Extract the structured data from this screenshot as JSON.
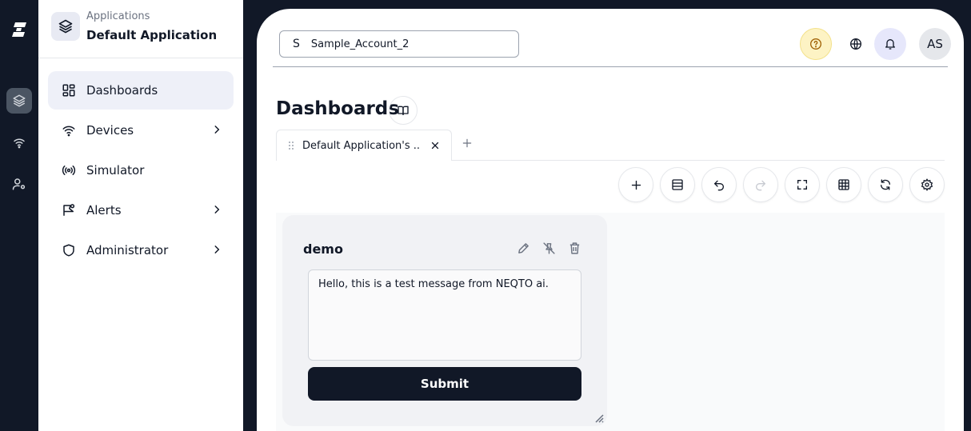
{
  "sidebar": {
    "app_label": "Applications",
    "app_name": "Default Application",
    "items": [
      {
        "label": "Dashboards",
        "icon": "dashboard-icon"
      },
      {
        "label": "Devices",
        "icon": "wifi-icon"
      },
      {
        "label": "Simulator",
        "icon": "broadcast-icon"
      },
      {
        "label": "Alerts",
        "icon": "alert-flag-icon"
      },
      {
        "label": "Administrator",
        "icon": "shield-icon"
      }
    ]
  },
  "header": {
    "account_initial": "S",
    "account_name": "Sample_Account_2",
    "avatar_initials": "AS"
  },
  "page": {
    "title": "Dashboards",
    "tab_label": "Default Application's ..."
  },
  "widget": {
    "title": "demo",
    "message": "Hello, this is a test message from NEQTO ai.",
    "submit_label": "Submit"
  },
  "colors": {
    "rail_bg": "#111827",
    "active_nav": "#eef0f8",
    "help_bg": "#fdf3c4",
    "bell_bg": "#e6e7fb",
    "submit_bg": "#111827"
  }
}
